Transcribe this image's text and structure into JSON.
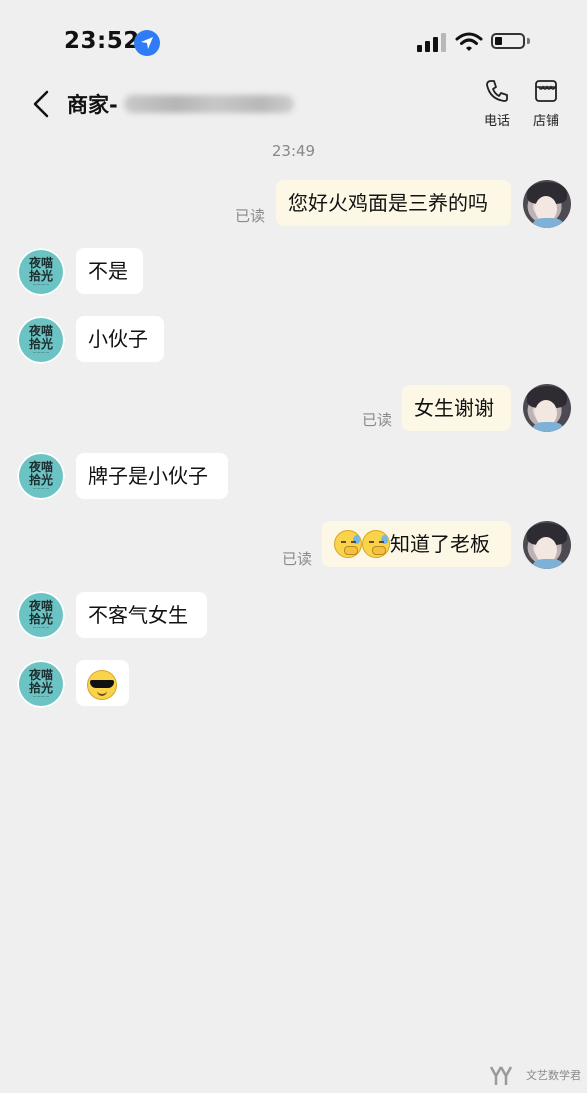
{
  "status_bar": {
    "time": "23:52"
  },
  "nav": {
    "title": "商家-",
    "phone_label": "电话",
    "store_label": "店铺"
  },
  "chat": {
    "timestamp": "23:49",
    "read_label": "已读",
    "shop_avatar_line1": "夜喵",
    "shop_avatar_line2": "拾光",
    "messages": [
      {
        "side": "out",
        "text": "您好火鸡面是三养的吗",
        "read": "已读"
      },
      {
        "side": "in",
        "text": "不是"
      },
      {
        "side": "in",
        "text": "小伙子"
      },
      {
        "side": "out",
        "text": "女生谢谢",
        "read": "已读"
      },
      {
        "side": "in",
        "text": "牌子是小伙子"
      },
      {
        "side": "out",
        "text": "知道了老板",
        "emojis": [
          "worried-emoji",
          "worried-emoji"
        ],
        "read": "已读"
      },
      {
        "side": "in",
        "text": "不客气女生"
      },
      {
        "side": "in",
        "text": "",
        "emojis": [
          "sunglasses-emoji"
        ]
      }
    ]
  },
  "watermark": {
    "text": "文艺数学君"
  },
  "colors": {
    "background": "#efefef",
    "incoming_bubble": "#ffffff",
    "outgoing_bubble": "#fdf8e6",
    "location_blue": "#2f7cf6",
    "shop_avatar": "#6cc3c4"
  }
}
